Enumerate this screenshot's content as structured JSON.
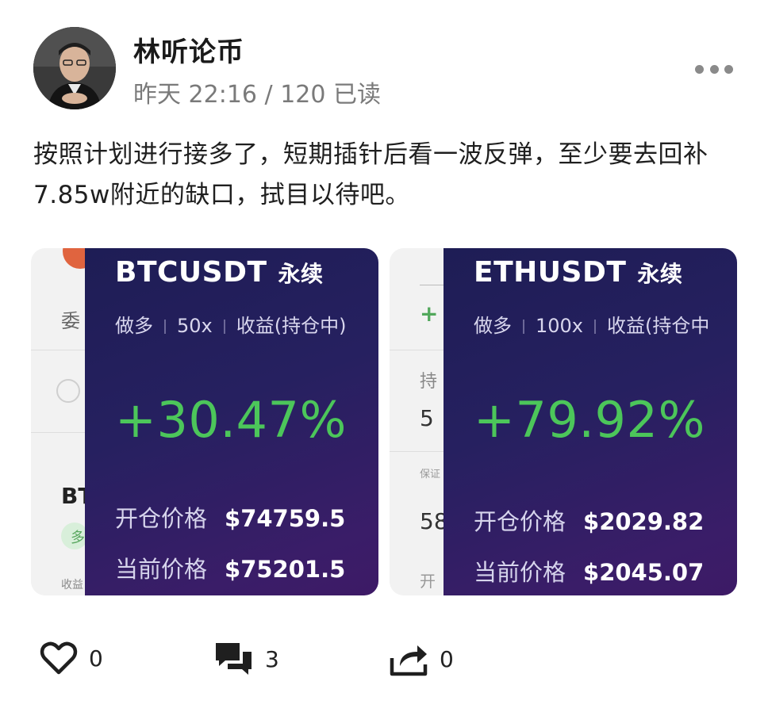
{
  "author": {
    "name": "林听论币",
    "time": "昨天 22:16",
    "reads": "120 已读"
  },
  "post_text": "按照计划进行接多了，短期插针后看一波反弹，至少要去回补7.85w附近的缺口，拭目以待吧。",
  "cards": [
    {
      "pair": "BTCUSDT",
      "contract": "永续",
      "side": "做多",
      "leverage": "50x",
      "status": "收益(持仓中)",
      "pnl": "+30.47%",
      "open_label": "开仓价格",
      "open_price": "$74759.5",
      "current_label": "当前价格",
      "current_price": "$75201.5",
      "bg_fragments": [
        "委",
        "BT",
        "多",
        "收益"
      ]
    },
    {
      "pair": "ETHUSDT",
      "contract": "永续",
      "side": "做多",
      "leverage": "100x",
      "status": "收益(持仓中",
      "pnl": "+79.92%",
      "open_label": "开仓价格",
      "open_price": "$2029.82",
      "current_label": "当前价格",
      "current_price": "$2045.07",
      "bg_fragments": [
        "+",
        "持",
        "5",
        "保证",
        "58",
        "开"
      ]
    }
  ],
  "actions": {
    "likes": "0",
    "comments": "3",
    "shares": "0"
  },
  "colors": {
    "profit": "#4cc65a",
    "panel": "#262060"
  },
  "icons": [
    "more-icon",
    "heart-icon",
    "comment-icon",
    "share-icon"
  ]
}
